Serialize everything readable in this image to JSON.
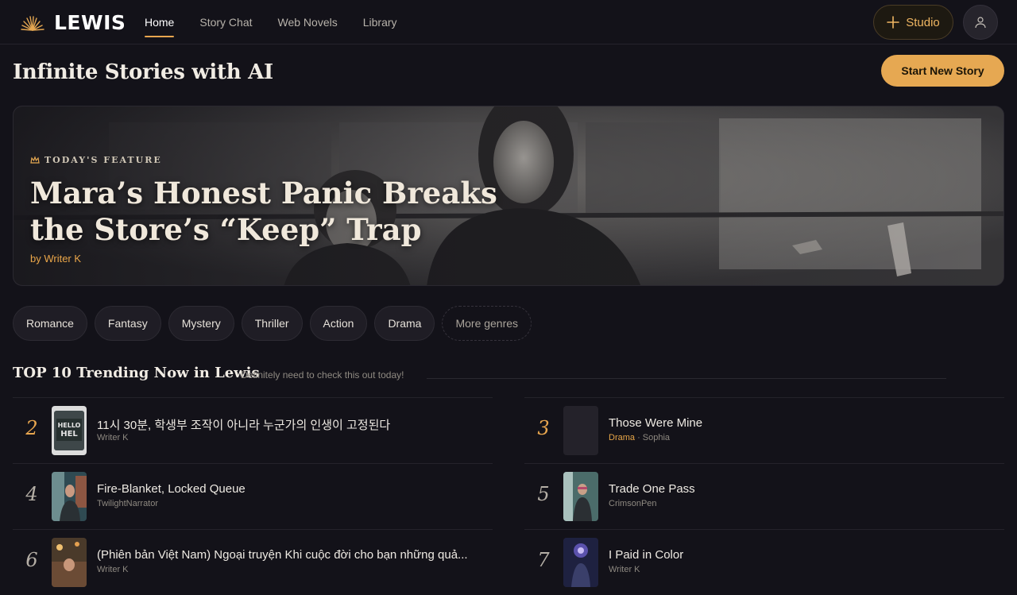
{
  "brand": {
    "name": "LEWIS",
    "logo_icon": "sunrise-rays-icon"
  },
  "nav": {
    "links": [
      {
        "label": "Home",
        "active": true
      },
      {
        "label": "Story Chat",
        "active": false
      },
      {
        "label": "Web Novels",
        "active": false
      },
      {
        "label": "Library",
        "active": false
      }
    ],
    "studio_label": "Studio",
    "profile_icon": "user-icon"
  },
  "header": {
    "title": "Infinite Stories with AI",
    "start_button": "Start New Story"
  },
  "hero": {
    "tag": "TODAY'S FEATURE",
    "tag_icon": "crown-icon",
    "title": "Mara’s Honest Panic Breaks the Store’s “Keep” Trap",
    "author": "by Writer K"
  },
  "genres": [
    "Romance",
    "Fantasy",
    "Mystery",
    "Thriller",
    "Action",
    "Drama"
  ],
  "more_genres": "More genres",
  "trending": {
    "title": "TOP 10 Trending Now in Lewis",
    "subtitle": "Definitely need to check this out today!",
    "left": [
      {
        "rank": "2",
        "title": "11시 30분, 학생부 조작이 아니라 누군가의 인생이 고정된다",
        "author": "Writer K",
        "genre": ""
      },
      {
        "rank": "4",
        "title": "Fire-Blanket, Locked Queue",
        "author": "TwilightNarrator",
        "genre": ""
      },
      {
        "rank": "6",
        "title": "(Phiên bản Việt Nam) Ngoại truyện Khi cuộc đời cho bạn những quả...",
        "author": "Writer K",
        "genre": ""
      }
    ],
    "right": [
      {
        "rank": "3",
        "title": "Those Were Mine",
        "author": "Sophia",
        "genre": "Drama"
      },
      {
        "rank": "5",
        "title": "Trade One Pass",
        "author": "CrimsonPen",
        "genre": ""
      },
      {
        "rank": "7",
        "title": "I Paid in Color",
        "author": "Writer K",
        "genre": ""
      }
    ]
  },
  "colors": {
    "accent": "#e6a852",
    "background": "#131219"
  }
}
